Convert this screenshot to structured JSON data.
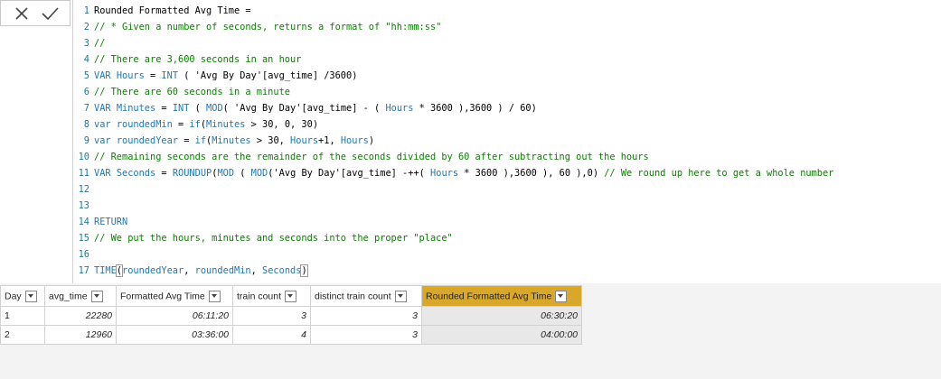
{
  "toolbar": {
    "cancel_icon": "close-icon",
    "commit_icon": "check-icon"
  },
  "editor": {
    "lines": [
      {
        "n": "1",
        "t": "Rounded Formatted Avg Time ="
      },
      {
        "n": "2",
        "t": "// * Given a number of seconds, returns a format of \"hh:mm:ss\""
      },
      {
        "n": "3",
        "t": "//"
      },
      {
        "n": "4",
        "t": "// There are 3,600 seconds in an hour"
      },
      {
        "n": "5",
        "t": "VAR Hours = INT ( 'Avg By Day'[avg_time] /3600)"
      },
      {
        "n": "6",
        "t": "// There are 60 seconds in a minute"
      },
      {
        "n": "7",
        "t": "VAR Minutes = INT ( MOD( 'Avg By Day'[avg_time] - ( Hours * 3600 ),3600 ) / 60)"
      },
      {
        "n": "8",
        "t": "var roundedMin = if(Minutes > 30, 0, 30)"
      },
      {
        "n": "9",
        "t": "var roundedYear = if(Minutes > 30, Hours+1, Hours)"
      },
      {
        "n": "10",
        "t": "// Remaining seconds are the remainder of the seconds divided by 60 after subtracting out the hours"
      },
      {
        "n": "11",
        "t": "VAR Seconds = ROUNDUP(MOD ( MOD('Avg By Day'[avg_time] -++( Hours * 3600 ),3600 ), 60 ),0) // We round up here to get a whole number"
      },
      {
        "n": "12",
        "t": ""
      },
      {
        "n": "13",
        "t": ""
      },
      {
        "n": "14",
        "t": "RETURN"
      },
      {
        "n": "15",
        "t": "// We put the hours, minutes and seconds into the proper \"place\""
      },
      {
        "n": "16",
        "t": ""
      },
      {
        "n": "17",
        "t": "TIME(roundedYear, roundedMin, Seconds)"
      }
    ]
  },
  "table": {
    "columns": [
      "Day",
      "avg_time",
      "Formatted Avg Time",
      "train count",
      "distinct train count",
      "Rounded Formatted Avg Time"
    ],
    "rows": [
      [
        "1",
        "22280",
        "06:11:20",
        "3",
        "3",
        "06:30:20"
      ],
      [
        "2",
        "12960",
        "03:36:00",
        "4",
        "3",
        "04:00:00"
      ]
    ]
  },
  "colors": {
    "selected_header": "#d9a82b",
    "keyword": "#1f77b4",
    "comment": "#0a8000"
  }
}
